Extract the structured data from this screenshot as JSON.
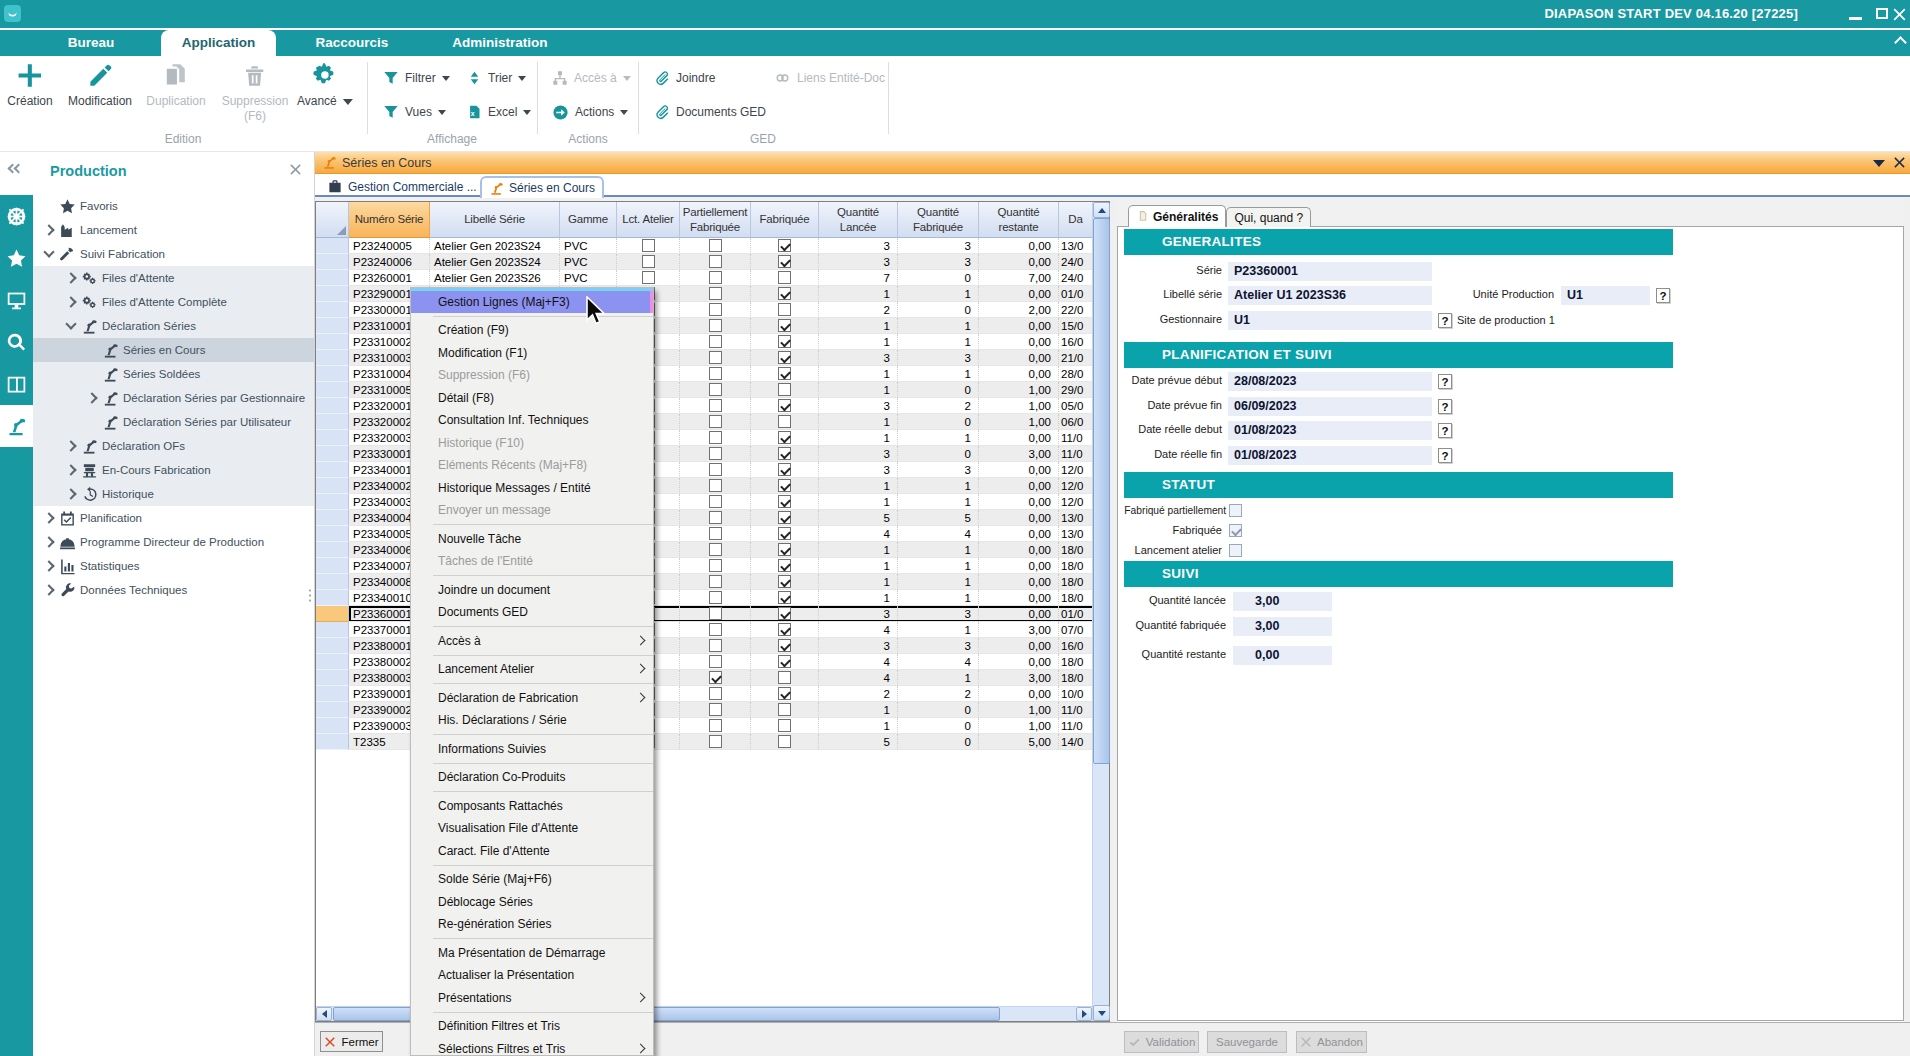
{
  "titlebar": {
    "title": "DIAPASON START DEV 04.16.20 [27225]"
  },
  "menubar": {
    "tabs": [
      {
        "label": "Bureau",
        "active": false
      },
      {
        "label": "Application",
        "active": true
      },
      {
        "label": "Raccourcis",
        "active": false
      },
      {
        "label": "Administration",
        "active": false
      }
    ]
  },
  "ribbon": {
    "creation": "Création",
    "modification": "Modification",
    "duplication": "Duplication",
    "suppression": "Suppression",
    "suppression2": "(F6)",
    "avance": "Avancé",
    "filtrer": "Filtrer",
    "trier": "Trier",
    "vues": "Vues",
    "excel": "Excel",
    "acces": "Accès à",
    "actions": "Actions",
    "joindre": "Joindre",
    "documents_ged": "Documents GED",
    "liens": "Liens Entité-Doc",
    "group_edition": "Edition",
    "group_affichage": "Affichage",
    "group_actions": "Actions",
    "group_ged": "GED"
  },
  "sidebar": {
    "title": "Production",
    "strip": [
      {
        "icon": "#i-wheel",
        "active": false,
        "name": "settings"
      },
      {
        "icon": "#i-star",
        "active": false,
        "name": "favorites"
      },
      {
        "icon": "#i-monitor",
        "active": false,
        "name": "desktop"
      },
      {
        "icon": "#i-search",
        "active": false,
        "name": "search"
      },
      {
        "icon": "#i-columns",
        "active": false,
        "name": "layout"
      },
      {
        "icon": "#i-robot",
        "active": true,
        "name": "production"
      }
    ],
    "tree": [
      {
        "label": "Favoris",
        "icon": "#i-star",
        "level": "1",
        "arrow": "",
        "shaded": 0,
        "sel": 0
      },
      {
        "label": "Lancement",
        "icon": "#i-factory",
        "level": "1",
        "arrow": "r",
        "shaded": 0,
        "sel": 0
      },
      {
        "label": "Suivi Fabrication",
        "icon": "#i-hammer",
        "level": "1",
        "arrow": "d",
        "shaded": 0,
        "sel": 0
      },
      {
        "label": "Files d'Attente",
        "icon": "#i-gears",
        "level": "2",
        "arrow": "r",
        "shaded": 1,
        "sel": 0
      },
      {
        "label": "Files d'Attente Complète",
        "icon": "#i-gears",
        "level": "2",
        "arrow": "r",
        "shaded": 1,
        "sel": 0
      },
      {
        "label": "Déclaration Séries",
        "icon": "#i-robot",
        "level": "2",
        "arrow": "d",
        "shaded": 1,
        "sel": 0
      },
      {
        "label": "Séries en Cours",
        "icon": "#i-robot",
        "level": "3",
        "arrow": "",
        "shaded": 1,
        "sel": 1
      },
      {
        "label": "Séries Soldées",
        "icon": "#i-robot",
        "level": "3",
        "arrow": "",
        "shaded": 1,
        "sel": 0
      },
      {
        "label": "Déclaration Séries par Gestionnaire",
        "icon": "#i-robot",
        "level": "3",
        "arrow": "r",
        "shaded": 1,
        "sel": 0
      },
      {
        "label": "Déclaration Séries par Utilisateur",
        "icon": "#i-robot",
        "level": "3",
        "arrow": "",
        "shaded": 1,
        "sel": 0
      },
      {
        "label": "Déclaration OFs",
        "icon": "#i-robot",
        "level": "2",
        "arrow": "r",
        "shaded": 1,
        "sel": 0
      },
      {
        "label": "En-Cours Fabrication",
        "icon": "#i-machine",
        "level": "2",
        "arrow": "r",
        "shaded": 1,
        "sel": 0
      },
      {
        "label": "Historique",
        "icon": "#i-histclock",
        "level": "2",
        "arrow": "r",
        "shaded": 1,
        "sel": 0
      },
      {
        "label": "Planification",
        "icon": "#i-calendar",
        "level": "1",
        "arrow": "r",
        "shaded": 0,
        "sel": 0
      },
      {
        "label": "Programme Directeur de Production",
        "icon": "#i-hardhat",
        "level": "1",
        "arrow": "r",
        "shaded": 0,
        "sel": 0
      },
      {
        "label": "Statistiques",
        "icon": "#i-chart",
        "level": "1",
        "arrow": "r",
        "shaded": 0,
        "sel": 0
      },
      {
        "label": "Données Techniques",
        "icon": "#i-wrench",
        "level": "1",
        "arrow": "r",
        "shaded": 0,
        "sel": 0
      }
    ]
  },
  "window": {
    "title": "Séries en Cours",
    "tabs": [
      {
        "label": "Gestion Commerciale ..."
      },
      {
        "label": "Séries en Cours"
      }
    ]
  },
  "table": {
    "headers": {
      "numero": "Numéro Série",
      "libelle": "Libellé Série",
      "gamme": "Gamme",
      "lct": "Lct. Atelier",
      "part_fab": "Partiellement\nFabriquée",
      "fabriquee": "Fabriquée",
      "q_lancee": "Quantité\nLancée",
      "q_fabriquee": "Quantité\nFabriquée",
      "q_restante": "Quantité\nrestante",
      "date": "Da"
    },
    "rows": [
      {
        "num": "P23240005",
        "lib": "Atelier Gen 2023S24",
        "gam": "PVC",
        "lct": 0,
        "pf": 0,
        "fab": 1,
        "ql": "3",
        "qf": "3",
        "qr": "0,00",
        "date": "13/0",
        "sel": 0
      },
      {
        "num": "P23240006",
        "lib": "Atelier Gen 2023S24",
        "gam": "PVC",
        "lct": 0,
        "pf": 0,
        "fab": 1,
        "ql": "3",
        "qf": "3",
        "qr": "0,00",
        "date": "24/0",
        "sel": 0
      },
      {
        "num": "P23260001",
        "lib": "Atelier Gen 2023S26",
        "gam": "PVC",
        "lct": 0,
        "pf": 0,
        "fab": 0,
        "ql": "7",
        "qf": "0",
        "qr": "7,00",
        "date": "24/0",
        "sel": 0
      },
      {
        "num": "P23290001",
        "lib": "",
        "gam": "",
        "lct": 0,
        "pf": 0,
        "fab": 1,
        "ql": "1",
        "qf": "1",
        "qr": "0,00",
        "date": "01/0",
        "sel": 0
      },
      {
        "num": "P23300001",
        "lib": "",
        "gam": "",
        "lct": 0,
        "pf": 0,
        "fab": 0,
        "ql": "2",
        "qf": "0",
        "qr": "2,00",
        "date": "22/0",
        "sel": 0
      },
      {
        "num": "P23310001",
        "lib": "",
        "gam": "",
        "lct": 0,
        "pf": 0,
        "fab": 1,
        "ql": "1",
        "qf": "1",
        "qr": "0,00",
        "date": "15/0",
        "sel": 0
      },
      {
        "num": "P23310002",
        "lib": "",
        "gam": "",
        "lct": 0,
        "pf": 0,
        "fab": 1,
        "ql": "1",
        "qf": "1",
        "qr": "0,00",
        "date": "16/0",
        "sel": 0
      },
      {
        "num": "P23310003",
        "lib": "",
        "gam": "",
        "lct": 0,
        "pf": 0,
        "fab": 1,
        "ql": "3",
        "qf": "3",
        "qr": "0,00",
        "date": "21/0",
        "sel": 0
      },
      {
        "num": "P23310004",
        "lib": "",
        "gam": "",
        "lct": 0,
        "pf": 0,
        "fab": 1,
        "ql": "1",
        "qf": "1",
        "qr": "0,00",
        "date": "28/0",
        "sel": 0
      },
      {
        "num": "P23310005",
        "lib": "",
        "gam": "",
        "lct": 0,
        "pf": 0,
        "fab": 0,
        "ql": "1",
        "qf": "0",
        "qr": "1,00",
        "date": "29/0",
        "sel": 0
      },
      {
        "num": "P23320001",
        "lib": "",
        "gam": "",
        "lct": 0,
        "pf": 0,
        "fab": 1,
        "ql": "3",
        "qf": "2",
        "qr": "1,00",
        "date": "05/0",
        "sel": 0
      },
      {
        "num": "P23320002",
        "lib": "",
        "gam": "",
        "lct": 0,
        "pf": 0,
        "fab": 0,
        "ql": "1",
        "qf": "0",
        "qr": "1,00",
        "date": "06/0",
        "sel": 0
      },
      {
        "num": "P23320003",
        "lib": "",
        "gam": "",
        "lct": 0,
        "pf": 0,
        "fab": 1,
        "ql": "1",
        "qf": "1",
        "qr": "0,00",
        "date": "11/0",
        "sel": 0
      },
      {
        "num": "P23330001",
        "lib": "",
        "gam": "",
        "lct": 0,
        "pf": 0,
        "fab": 1,
        "ql": "3",
        "qf": "0",
        "qr": "3,00",
        "date": "11/0",
        "sel": 0
      },
      {
        "num": "P23340001",
        "lib": "",
        "gam": "",
        "lct": 0,
        "pf": 0,
        "fab": 1,
        "ql": "3",
        "qf": "3",
        "qr": "0,00",
        "date": "12/0",
        "sel": 0
      },
      {
        "num": "P23340002",
        "lib": "",
        "gam": "",
        "lct": 0,
        "pf": 0,
        "fab": 1,
        "ql": "1",
        "qf": "1",
        "qr": "0,00",
        "date": "12/0",
        "sel": 0
      },
      {
        "num": "P23340003",
        "lib": "",
        "gam": "",
        "lct": 0,
        "pf": 0,
        "fab": 1,
        "ql": "1",
        "qf": "1",
        "qr": "0,00",
        "date": "12/0",
        "sel": 0
      },
      {
        "num": "P23340004",
        "lib": "",
        "gam": "",
        "lct": 0,
        "pf": 0,
        "fab": 1,
        "ql": "5",
        "qf": "5",
        "qr": "0,00",
        "date": "13/0",
        "sel": 0
      },
      {
        "num": "P23340005",
        "lib": "",
        "gam": "",
        "lct": 0,
        "pf": 0,
        "fab": 1,
        "ql": "4",
        "qf": "4",
        "qr": "0,00",
        "date": "13/0",
        "sel": 0
      },
      {
        "num": "P23340006",
        "lib": "",
        "gam": "",
        "lct": 0,
        "pf": 0,
        "fab": 1,
        "ql": "1",
        "qf": "1",
        "qr": "0,00",
        "date": "18/0",
        "sel": 0
      },
      {
        "num": "P23340007",
        "lib": "",
        "gam": "",
        "lct": 0,
        "pf": 0,
        "fab": 1,
        "ql": "1",
        "qf": "1",
        "qr": "0,00",
        "date": "18/0",
        "sel": 0
      },
      {
        "num": "P23340008",
        "lib": "",
        "gam": "",
        "lct": 0,
        "pf": 0,
        "fab": 1,
        "ql": "1",
        "qf": "1",
        "qr": "0,00",
        "date": "18/0",
        "sel": 0
      },
      {
        "num": "P23340010",
        "lib": "",
        "gam": "",
        "lct": 0,
        "pf": 0,
        "fab": 1,
        "ql": "1",
        "qf": "1",
        "qr": "0,00",
        "date": "18/0",
        "sel": 0
      },
      {
        "num": "P23360001",
        "lib": "",
        "gam": "",
        "lct": 0,
        "pf": 0,
        "fab": 1,
        "ql": "3",
        "qf": "3",
        "qr": "0,00",
        "date": "01/0",
        "sel": 1
      },
      {
        "num": "P23370001",
        "lib": "",
        "gam": "",
        "lct": 0,
        "pf": 0,
        "fab": 1,
        "ql": "4",
        "qf": "1",
        "qr": "3,00",
        "date": "07/0",
        "sel": 0
      },
      {
        "num": "P23380001",
        "lib": "",
        "gam": "",
        "lct": 0,
        "pf": 0,
        "fab": 1,
        "ql": "3",
        "qf": "3",
        "qr": "0,00",
        "date": "16/0",
        "sel": 0
      },
      {
        "num": "P23380002",
        "lib": "",
        "gam": "",
        "lct": 0,
        "pf": 0,
        "fab": 1,
        "ql": "4",
        "qf": "4",
        "qr": "0,00",
        "date": "18/0",
        "sel": 0
      },
      {
        "num": "P23380003",
        "lib": "",
        "gam": "",
        "lct": 0,
        "pf": 1,
        "fab": 0,
        "ql": "4",
        "qf": "1",
        "qr": "3,00",
        "date": "18/0",
        "sel": 0
      },
      {
        "num": "P23390001",
        "lib": "",
        "gam": "",
        "lct": 0,
        "pf": 0,
        "fab": 1,
        "ql": "2",
        "qf": "2",
        "qr": "0,00",
        "date": "10/0",
        "sel": 0
      },
      {
        "num": "P23390002",
        "lib": "",
        "gam": "",
        "lct": 0,
        "pf": 0,
        "fab": 0,
        "ql": "1",
        "qf": "0",
        "qr": "1,00",
        "date": "11/0",
        "sel": 0
      },
      {
        "num": "P23390003",
        "lib": "",
        "gam": "",
        "lct": 0,
        "pf": 0,
        "fab": 0,
        "ql": "1",
        "qf": "0",
        "qr": "1,00",
        "date": "11/0",
        "sel": 0
      },
      {
        "num": "T2335",
        "lib": "",
        "gam": "",
        "lct": 0,
        "pf": 0,
        "fab": 0,
        "ql": "5",
        "qf": "0",
        "qr": "5,00",
        "date": "14/0",
        "sel": 0
      }
    ]
  },
  "menu": {
    "items": [
      {
        "label": "Gestion Lignes (Maj+F3)",
        "hl": 1
      },
      {
        "sep": 1
      },
      {
        "label": "Création (F9)"
      },
      {
        "label": "Modification (F1)"
      },
      {
        "label": "Suppression (F6)",
        "dis": 1
      },
      {
        "label": "Détail (F8)"
      },
      {
        "label": "Consultation Inf. Techniques"
      },
      {
        "label": "Historique (F10)",
        "dis": 1
      },
      {
        "label": "Eléments Récents (Maj+F8)",
        "dis": 1
      },
      {
        "label": "Historique Messages / Entité"
      },
      {
        "label": "Envoyer un message",
        "dis": 1
      },
      {
        "sep": 1
      },
      {
        "label": "Nouvelle Tâche"
      },
      {
        "label": "Tâches de l'Entité",
        "dis": 1
      },
      {
        "sep": 1
      },
      {
        "label": "Joindre un document"
      },
      {
        "label": "Documents GED"
      },
      {
        "sep": 1
      },
      {
        "label": "Accès à",
        "sub": 1
      },
      {
        "sep": 1
      },
      {
        "label": "Lancement Atelier",
        "sub": 1
      },
      {
        "sep": 1
      },
      {
        "label": "Déclaration de Fabrication",
        "sub": 1
      },
      {
        "label": "His. Déclarations / Série"
      },
      {
        "sep": 1
      },
      {
        "label": "Informations Suivies"
      },
      {
        "sep": 1
      },
      {
        "label": "Déclaration Co-Produits"
      },
      {
        "sep": 1
      },
      {
        "label": "Composants Rattachés"
      },
      {
        "label": "Visualisation File d'Attente"
      },
      {
        "label": "Caract. File d'Attente"
      },
      {
        "sep": 1
      },
      {
        "label": "Solde Série (Maj+F6)"
      },
      {
        "label": "Déblocage Séries"
      },
      {
        "label": "Re-génération Séries"
      },
      {
        "sep": 1
      },
      {
        "label": "Ma Présentation de Démarrage"
      },
      {
        "label": "Actualiser la Présentation"
      },
      {
        "label": "Présentations",
        "sub": 1
      },
      {
        "sep": 1
      },
      {
        "label": "Définition Filtres et Tris"
      },
      {
        "label": "Sélections Filtres et Tris",
        "sub": 1
      }
    ]
  },
  "panel": {
    "tabs": [
      {
        "label": "Généralités"
      },
      {
        "label": "Qui, quand ?"
      }
    ],
    "sections": {
      "generalites": "GENERALITES",
      "planification": "PLANIFICATION ET SUIVI",
      "statut": "STATUT",
      "suivi": "SUIVI"
    },
    "fields": {
      "serie_label": "Série",
      "serie": "P23360001",
      "libelle_label": "Libellé série",
      "libelle": "Atelier U1 2023S36",
      "unite_label": "Unité Production",
      "unite": "U1",
      "gestionnaire_label": "Gestionnaire",
      "gestionnaire": "U1",
      "site_label": "Site de production 1",
      "date_prevue_debut_label": "Date prévue début",
      "date_prevue_debut": "28/08/2023",
      "date_prevue_fin_label": "Date prévue fin",
      "date_prevue_fin": "06/09/2023",
      "date_reelle_debut_label": "Date réelle debut",
      "date_reelle_debut": "01/08/2023",
      "date_reelle_fin_label": "Date réelle fin",
      "date_reelle_fin": "01/08/2023",
      "fab_part_label": "Fabriqué partiellement",
      "fabriquee_label": "Fabriquée",
      "lancement_label": "Lancement atelier",
      "q_lancee_label": "Quantité lancée",
      "q_lancee": "3,00",
      "q_fabriquee_label": "Quantité fabriquée",
      "q_fabriquee": "3,00",
      "q_restante_label": "Quantité restante",
      "q_restante": "0,00",
      "help": "?"
    }
  },
  "footer": {
    "fermer": "Fermer",
    "validation": "Validation",
    "sauvegarde": "Sauvegarde",
    "abandon": "Abandon"
  }
}
